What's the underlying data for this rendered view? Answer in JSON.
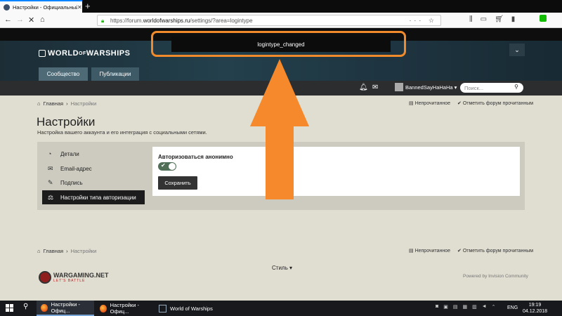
{
  "browser": {
    "tab_title": "Настройки - Официальный ф",
    "url_host": "https://forum.",
    "url_domain": "worldofwarships.ru",
    "url_path": "/settings/?area=logintype"
  },
  "toast": {
    "text": "logintype_changed"
  },
  "site": {
    "logo_text": "WORLD",
    "logo_small": "OF",
    "logo_text2": "WARSHIPS",
    "tabs": [
      "Сообщество",
      "Публикации"
    ],
    "username": "BannedSayHaHaHa",
    "search_placeholder": "Поиск..."
  },
  "breadcrumb": {
    "home": "Главная",
    "current": "Настройки",
    "sep": "›"
  },
  "actions": {
    "unread": "Непрочитанное",
    "mark_read": "Отметить форум прочитанным"
  },
  "page": {
    "title": "Настройки",
    "subtitle": "Настройка вашего аккаунта и его интеграция с социальными сетями."
  },
  "sidebar": {
    "items": [
      {
        "label": "Детали",
        "icon": "dashboard-icon"
      },
      {
        "label": "Email-адрес",
        "icon": "envelope-icon"
      },
      {
        "label": "Подпись",
        "icon": "pencil-icon"
      },
      {
        "label": "Настройки типа авторизации",
        "icon": "scales-icon"
      }
    ]
  },
  "form": {
    "option_label": "Авторизоваться анонимно",
    "toggle_on": true,
    "save_label": "Сохранить"
  },
  "footer": {
    "style_label": "Стиль",
    "wg_name": "WARGAMING.NET",
    "wg_slogan": "LET'S BATTLE",
    "powered": "Powered by Invision Community"
  },
  "taskbar": {
    "items": [
      "Настройки - Офиц...",
      "Настройки - Офиц...",
      "World of Warships"
    ],
    "lang": "ENG",
    "time": "19:19",
    "date": "04.12.2018"
  },
  "colors": {
    "accent": "#f08a2b",
    "toggle": "#4f6f57",
    "dark": "#1c1c1c"
  }
}
